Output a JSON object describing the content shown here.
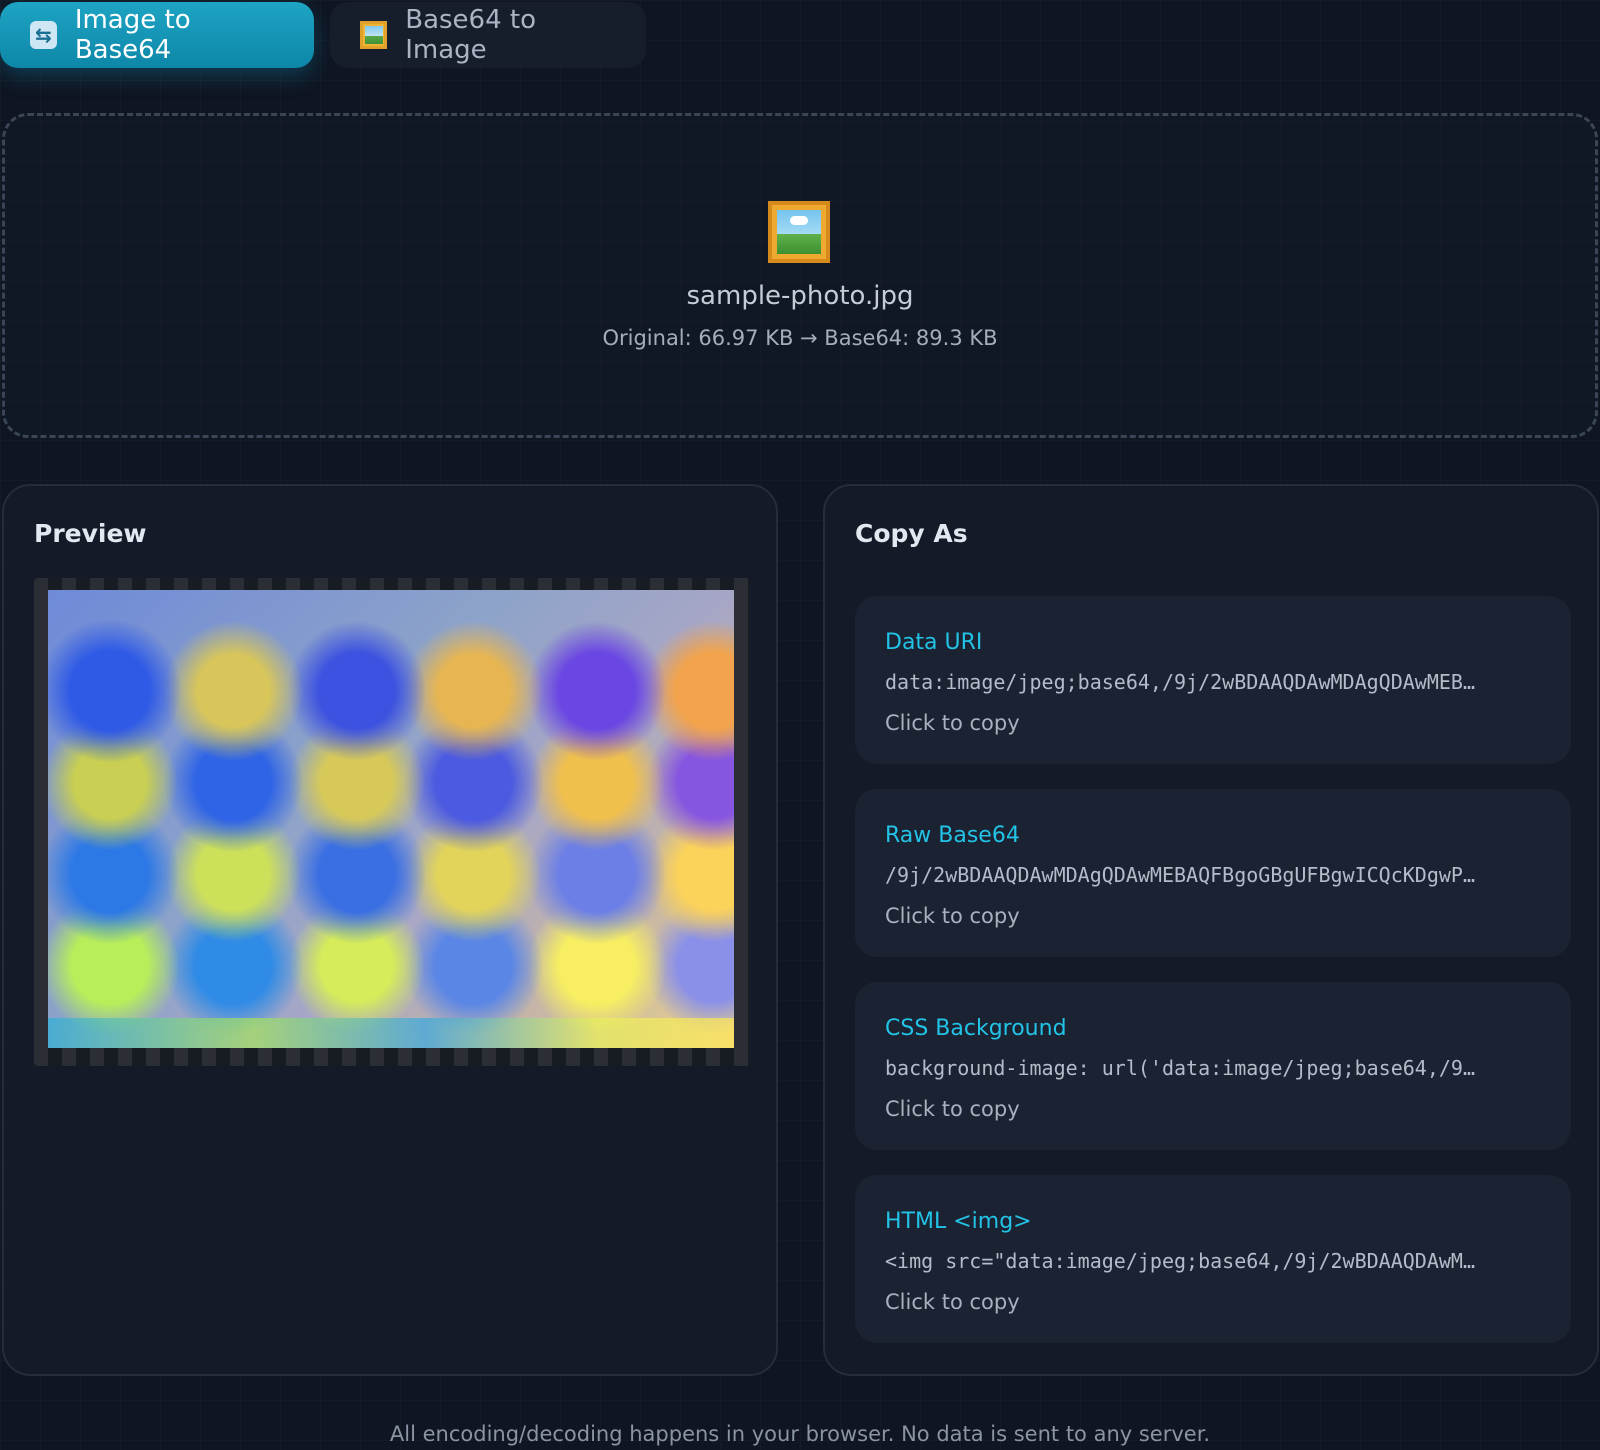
{
  "tabs": [
    {
      "label": "Image to Base64",
      "icon": "sync-icon",
      "active": true
    },
    {
      "label": "Base64 to Image",
      "icon": "framed-picture-icon",
      "active": false
    }
  ],
  "dropzone": {
    "icon": "framed-picture-icon",
    "file_name": "sample-photo.jpg",
    "sizes": "Original: 66.97 KB → Base64: 89.3 KB"
  },
  "preview": {
    "title": "Preview"
  },
  "copy_as": {
    "title": "Copy As",
    "items": [
      {
        "label": "Data URI",
        "value": "data:image/jpeg;base64,/9j/2wBDAAQDAwMDAgQDAwMEB…",
        "hint": "Click to copy"
      },
      {
        "label": "Raw Base64",
        "value": "/9j/2wBDAAQDAwMDAgQDAwMEBAQFBgoGBgUFBgwICQcKDgwP…",
        "hint": "Click to copy"
      },
      {
        "label": "CSS Background",
        "value": "background-image: url('data:image/jpeg;base64,/9…",
        "hint": "Click to copy"
      },
      {
        "label": "HTML <img>",
        "value": "<img src=\"data:image/jpeg;base64,/9j/2wBDAAQDAwM…",
        "hint": "Click to copy"
      }
    ]
  },
  "footer": "All encoding/decoding happens in your browser. No data is sent to any server.",
  "colors": {
    "accent": "#1ea4c4",
    "label": "#22c3e6",
    "background": "#0f1522"
  }
}
